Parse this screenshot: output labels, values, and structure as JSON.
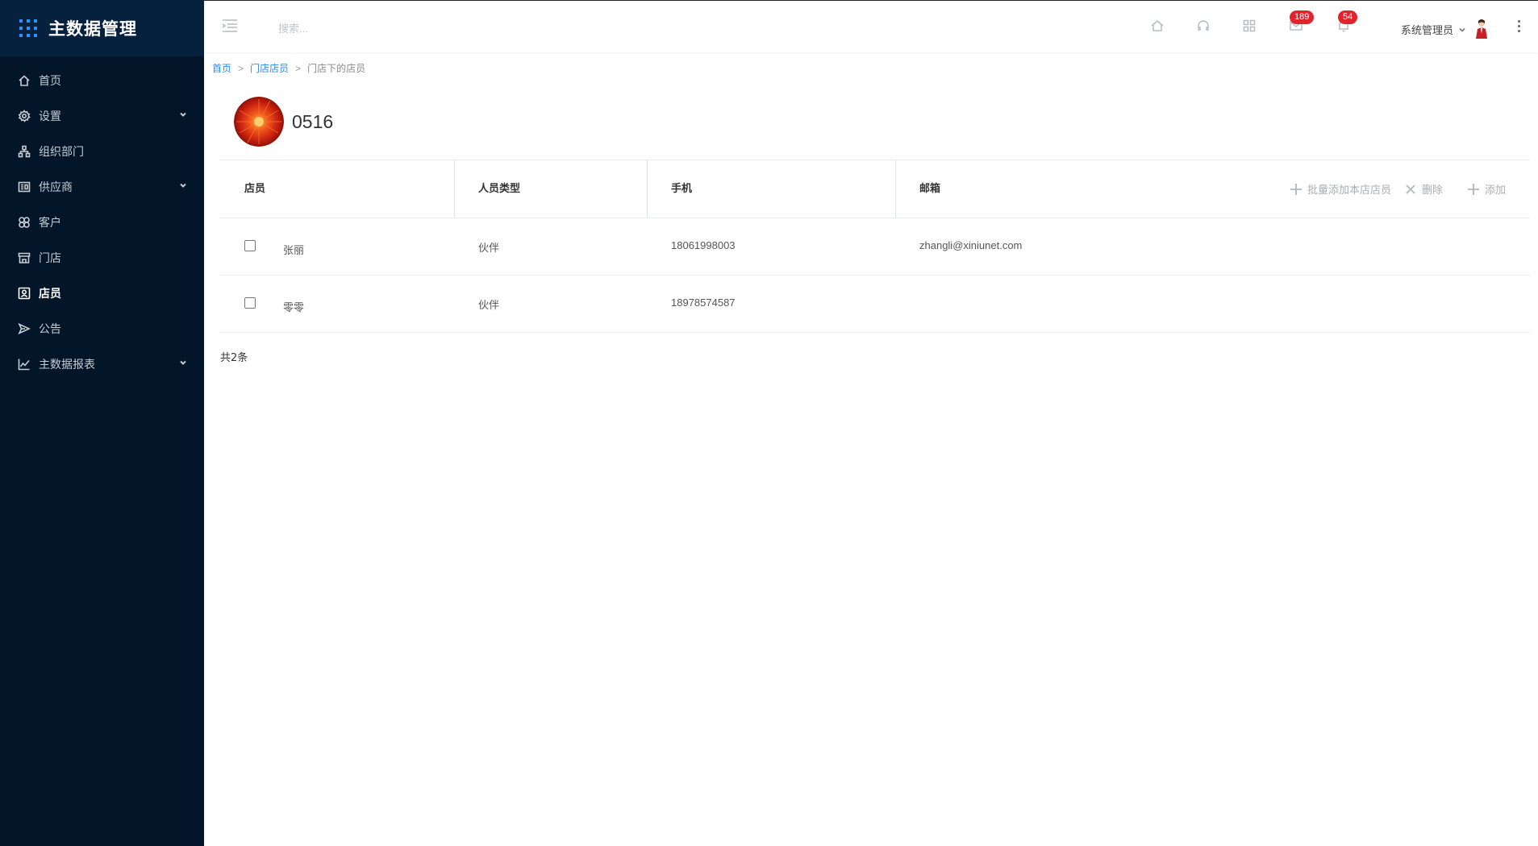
{
  "app": {
    "title": "主数据管理"
  },
  "sidebar": {
    "items": [
      {
        "label": "首页",
        "icon": "home-icon",
        "expandable": false,
        "active": false
      },
      {
        "label": "设置",
        "icon": "gear-icon",
        "expandable": true,
        "active": false
      },
      {
        "label": "组织部门",
        "icon": "org-tree-icon",
        "expandable": false,
        "active": false
      },
      {
        "label": "供应商",
        "icon": "supplier-icon",
        "expandable": true,
        "active": false
      },
      {
        "label": "客户",
        "icon": "customer-icon",
        "expandable": false,
        "active": false
      },
      {
        "label": "门店",
        "icon": "store-icon",
        "expandable": false,
        "active": false
      },
      {
        "label": "店员",
        "icon": "staff-icon",
        "expandable": false,
        "active": true
      },
      {
        "label": "公告",
        "icon": "announcement-icon",
        "expandable": false,
        "active": false
      },
      {
        "label": "主数据报表",
        "icon": "report-chart-icon",
        "expandable": true,
        "active": false
      }
    ]
  },
  "header": {
    "search_placeholder": "搜索...",
    "mail_badge": "189",
    "bell_badge": "54",
    "user_name": "系统管理员"
  },
  "breadcrumb": {
    "home": "首页",
    "sep1": ">",
    "parent": "门店店员",
    "sep2": ">",
    "current": "门店下的店员"
  },
  "store": {
    "name": "0516"
  },
  "table": {
    "columns": [
      "店员",
      "人员类型",
      "手机",
      "邮箱"
    ],
    "actions": {
      "batch_add": "批量添加本店店员",
      "delete": "删除",
      "add": "添加"
    },
    "rows": [
      {
        "name": "张丽",
        "type": "伙伴",
        "phone": "18061998003",
        "email": "zhangli@xiniunet.com"
      },
      {
        "name": "零零",
        "type": "伙伴",
        "phone": "18978574587",
        "email": ""
      }
    ],
    "total": "共2条"
  },
  "colors": {
    "sidebar_bg": "#031528",
    "brand_bg": "#06213d",
    "accent": "#2d8cf0",
    "badge": "#e3232c"
  }
}
